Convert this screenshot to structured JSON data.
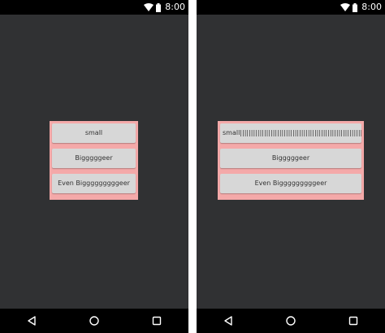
{
  "status_bar": {
    "time": "8:00"
  },
  "screens": {
    "left": {
      "buttons": [
        "small",
        "Bigggggeer",
        "Even Bigggggggggeer"
      ]
    },
    "right": {
      "buttons": [
        "small||||||||||||||||||||||||||||||||||||||||||||||||||||||||||||||||||||||||||||",
        "Bigggggeer",
        "Even Bigggggggggeer"
      ]
    }
  },
  "colors": {
    "background": "#303133",
    "container": "#f4a9a9",
    "button": "#d7d7d7"
  }
}
